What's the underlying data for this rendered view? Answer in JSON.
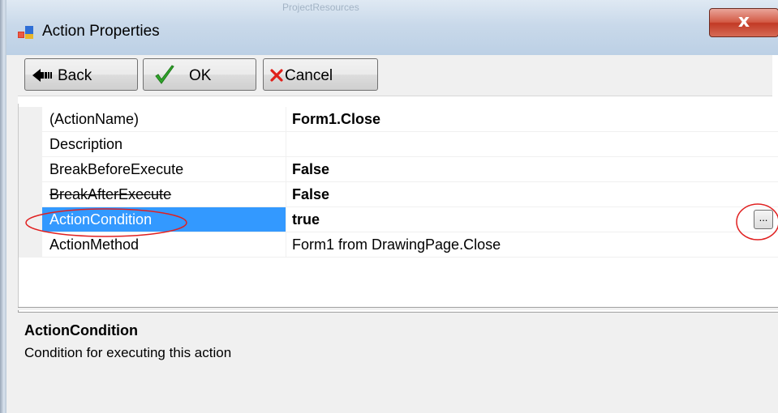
{
  "window": {
    "title": "Action Properties",
    "close_glyph": "x",
    "background_caption": "ProjectResources"
  },
  "toolbar": {
    "back_label": "Back",
    "ok_label": "OK",
    "cancel_label": "Cancel"
  },
  "properties": [
    {
      "name": "(ActionName)",
      "value": "Form1.Close",
      "bold": true
    },
    {
      "name": "Description",
      "value": "",
      "bold": false
    },
    {
      "name": "BreakBeforeExecute",
      "value": "False",
      "bold": true
    },
    {
      "name": "BreakAfterExecute",
      "value": "False",
      "bold": true
    },
    {
      "name": "ActionCondition",
      "value": "true",
      "bold": true,
      "selected": true
    },
    {
      "name": "ActionMethod",
      "value": "Form1 from DrawingPage.Close",
      "bold": false
    }
  ],
  "ellipsis_label": "...",
  "help": {
    "title": "ActionCondition",
    "description": "Condition for executing this action"
  },
  "colors": {
    "selection": "#3399ff",
    "annotation": "#e02020",
    "ok_check": "#2fa52a",
    "cancel_x": "#e0201a"
  }
}
